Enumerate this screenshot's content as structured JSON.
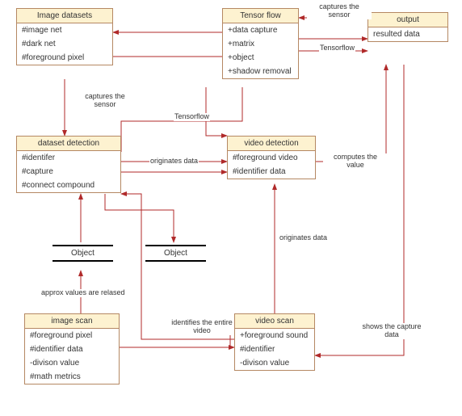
{
  "boxes": {
    "image_datasets": {
      "title": "Image datasets",
      "items": [
        "#image net",
        "#dark net",
        "#foreground pixel"
      ]
    },
    "tensor_flow": {
      "title": "Tensor flow",
      "items": [
        "+data capture",
        "+matrix",
        "+object",
        "+shadow removal"
      ]
    },
    "output": {
      "title": "output",
      "items": [
        "resulted data"
      ]
    },
    "dataset_detection": {
      "title": "dataset detection",
      "items": [
        "#identifer",
        "#capture",
        "#connect compound"
      ]
    },
    "video_detection": {
      "title": "video detection",
      "items": [
        "#foreground video",
        "#identifier data"
      ]
    },
    "image_scan": {
      "title": "image scan",
      "items": [
        "#foreground pixel",
        "#identifier data",
        "-divison value",
        "#math metrics"
      ]
    },
    "video_scan": {
      "title": "video scan",
      "items": [
        "+foreground sound",
        "#identifier",
        "-divison value"
      ]
    }
  },
  "objects": {
    "obj1": "Object",
    "obj2": "Object"
  },
  "labels": {
    "captures_sensor_top": "captures the sensor",
    "tensorflow_top": "Tensorflow",
    "captures_sensor_left": "captures the sensor",
    "tensorflow_mid": "Tensorflow",
    "originates_data_mid": "originates data",
    "computes_value": "computes the value",
    "originates_data_v": "originates data",
    "approx_values": "approx values are relased",
    "identifies_video": "identifies the entire video",
    "shows_capture": "shows the capture data"
  }
}
